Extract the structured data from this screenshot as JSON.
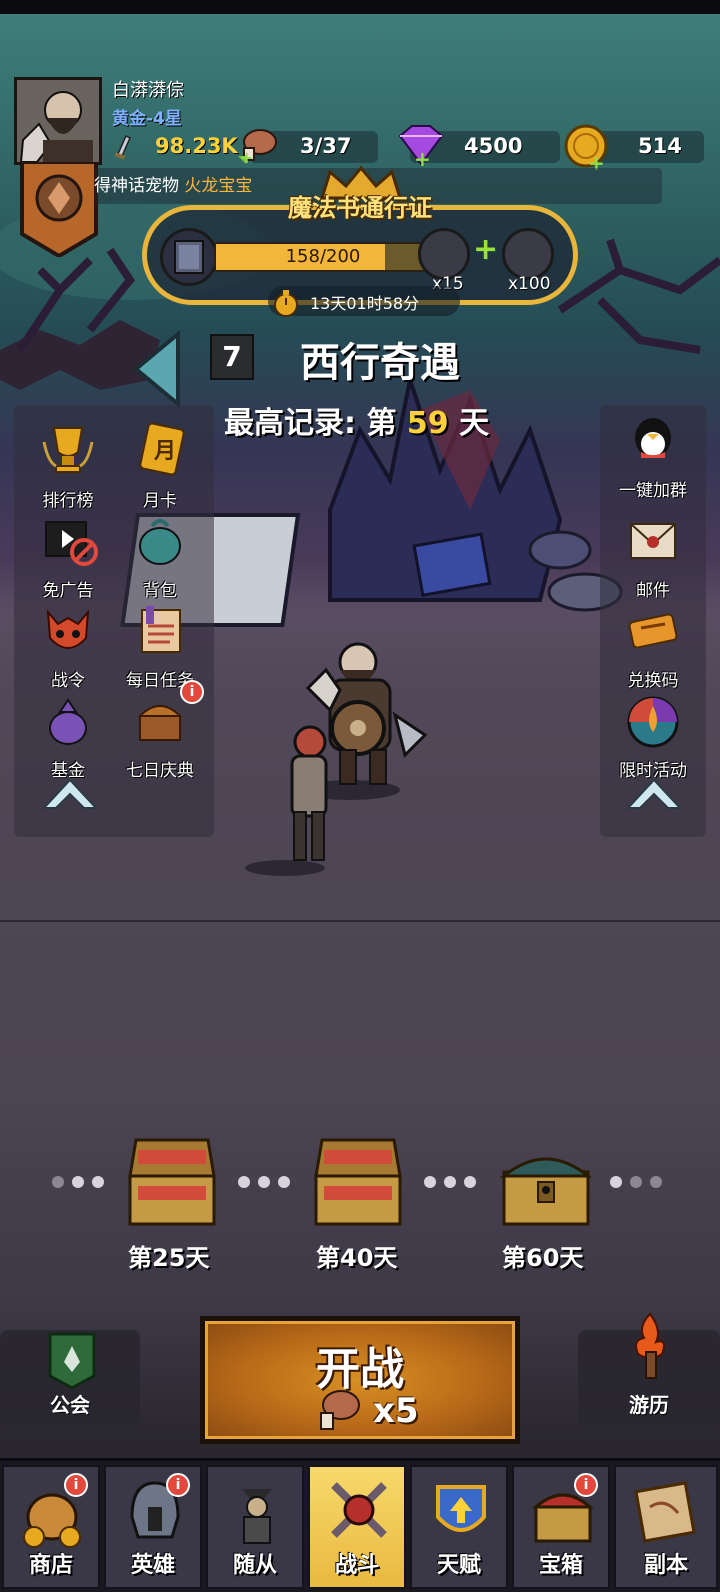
{
  "player": {
    "name": "白漭漭倧",
    "rank": "黄金-4星"
  },
  "resources": {
    "power": "98.23K",
    "stamina": "3/37",
    "gems": "4500",
    "coins": "514"
  },
  "marquee": {
    "prefix": "得神话宠物",
    "pet": "火龙宝宝"
  },
  "pass": {
    "title": "魔法书通行证",
    "progress_text": "158/200",
    "progress": 0.79,
    "reward1": "x15",
    "reward2": "x100",
    "timer": "13天01时58分"
  },
  "stage": {
    "number": "7",
    "title": "西行奇遇",
    "record_prefix": "最高记录: 第",
    "record_days": "59",
    "record_suffix": "天"
  },
  "left_menu": [
    {
      "label": "排行榜",
      "badge": ""
    },
    {
      "label": "月卡",
      "badge": ""
    },
    {
      "label": "免广告",
      "badge": ""
    },
    {
      "label": "背包",
      "badge": ""
    },
    {
      "label": "战令",
      "badge": ""
    },
    {
      "label": "每日任务",
      "badge": ""
    },
    {
      "label": "基金",
      "badge": ""
    },
    {
      "label": "七日庆典",
      "badge": "i"
    }
  ],
  "right_menu": [
    {
      "label": "一键加群"
    },
    {
      "label": "邮件"
    },
    {
      "label": "兑换码"
    },
    {
      "label": "限时活动"
    }
  ],
  "milestones": [
    {
      "label": "第25天"
    },
    {
      "label": "第40天"
    },
    {
      "label": "第60天"
    }
  ],
  "actions": {
    "guild": "公会",
    "battle": "开战",
    "battle_cost": "x5",
    "travel": "游历"
  },
  "nav": [
    {
      "label": "商店",
      "badge": "i",
      "active": false
    },
    {
      "label": "英雄",
      "badge": "i",
      "active": false
    },
    {
      "label": "随从",
      "badge": "",
      "active": false
    },
    {
      "label": "战斗",
      "badge": "",
      "active": true
    },
    {
      "label": "天赋",
      "badge": "",
      "active": false
    },
    {
      "label": "宝箱",
      "badge": "i",
      "active": false
    },
    {
      "label": "副本",
      "badge": "",
      "active": false
    }
  ],
  "colors": {
    "gold": "#ffd23a",
    "rank_blue": "#7fb2ff",
    "pet_orange": "#ffb43a",
    "badge_red": "#e3483c"
  }
}
